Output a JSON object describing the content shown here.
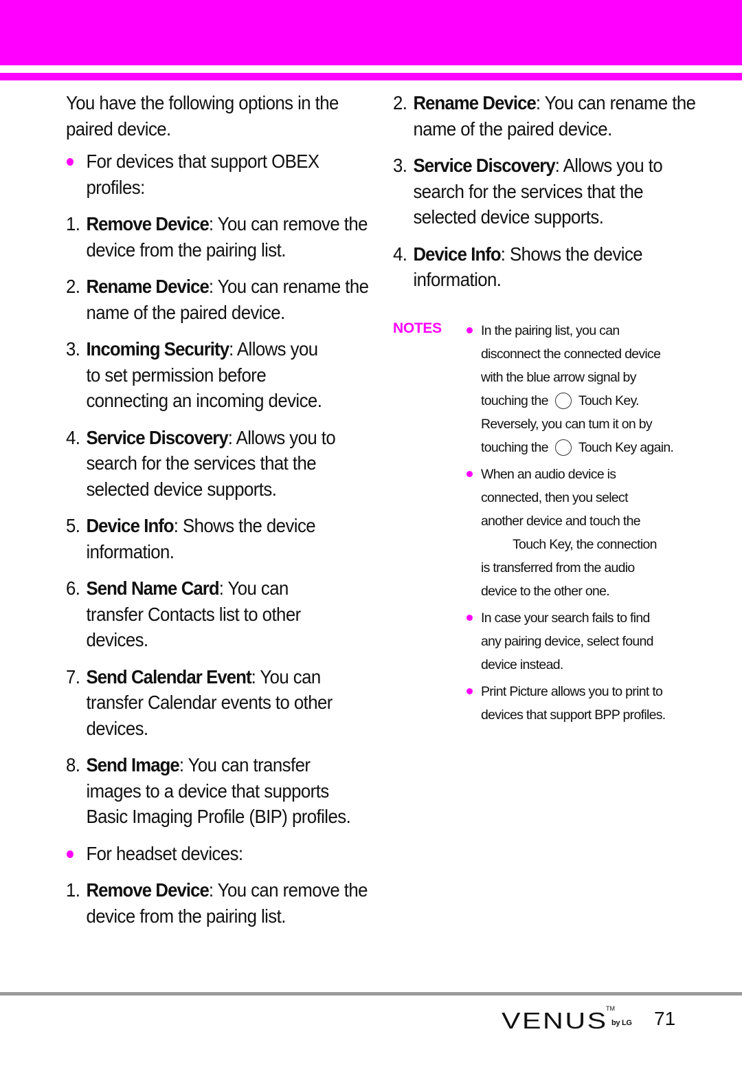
{
  "header": {
    "accent_color": "#ff00ff"
  },
  "left_column": {
    "intro": "You have the following options in the paired device.",
    "obex_heading": "For devices that support OBEX profiles:",
    "obex_items": [
      {
        "num": "1.",
        "term": "Remove Device",
        "text": ": You can remove the device from the pairing list."
      },
      {
        "num": "2.",
        "term": "Rename Device",
        "text": ": You can rename the name of the paired device."
      },
      {
        "num": "3.",
        "term": "Incoming Security",
        "text": ": Allows you to set permission before connecting an incoming device."
      },
      {
        "num": "4.",
        "term": "Service Discovery",
        "text": ": Allows you to search for the services that the selected device supports."
      },
      {
        "num": "5.",
        "term": "Device Info",
        "text": ": Shows the device information."
      },
      {
        "num": "6.",
        "term": "Send Name Card",
        "text": ": You can transfer Contacts list to other devices."
      },
      {
        "num": "7.",
        "term": "Send Calendar Event",
        "text": ": You can transfer Calendar events to other devices."
      },
      {
        "num": "8.",
        "term": "Send Image",
        "text": ": You can transfer images to a device that supports Basic Imaging Profile (BIP) profiles."
      }
    ],
    "headset_heading": "For headset devices:",
    "headset_items": [
      {
        "num": "1.",
        "term": "Remove Device",
        "text": ": You can remove the device from the pairing list."
      }
    ]
  },
  "right_column": {
    "items": [
      {
        "num": "2.",
        "term": "Rename Device",
        "text": ": You can rename the name of the paired device."
      },
      {
        "num": "3.",
        "term": "Service Discovery",
        "text": ": Allows you to search for the services that the selected device supports."
      },
      {
        "num": "4.",
        "term": "Device Info",
        "text": ": Shows the device information."
      }
    ],
    "notes_label": "NOTES",
    "notes": {
      "n1_a": "In the pairing list, you can disconnect the connected device with the blue arrow signal by touching the",
      "n1_b": "Touch Key. Reversely, you can tum it on by touching the",
      "n1_c": "Touch Key again.",
      "n2_a": "When an audio device is connected, then you select another device and touch the",
      "n2_b": "Touch Key, the connection is transferred from the audio device to the other one.",
      "n3": "In case your search fails to find any pairing device, select found device instead.",
      "n4": "Print Picture allows you to print to devices that support BPP profiles."
    }
  },
  "footer": {
    "brand": "VENUS",
    "brand_tm": "TM",
    "brand_by": "by LG",
    "page_number": "71"
  }
}
